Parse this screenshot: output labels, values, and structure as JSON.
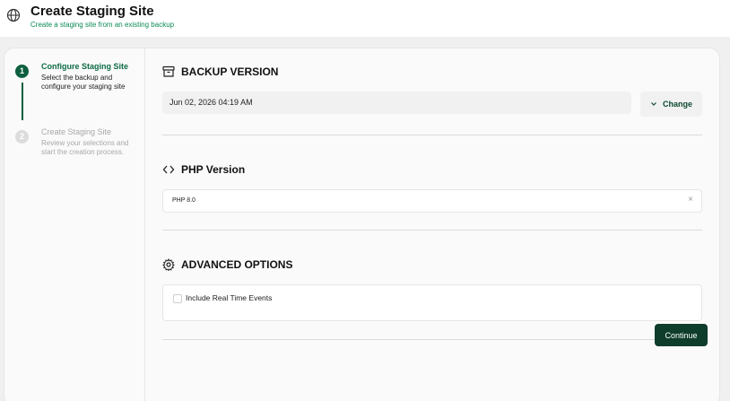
{
  "header": {
    "title": "Create Staging Site",
    "subtitle": "Create a staging site from an existing backup",
    "icon": "globe-icon"
  },
  "steps": [
    {
      "number": "1",
      "label": "Configure Staging Site",
      "description": "Select the backup and configure your staging site",
      "state": "active"
    },
    {
      "number": "2",
      "label": "Create Staging Site",
      "description": "Review your selections and start the creation process.",
      "state": "inactive"
    }
  ],
  "backup": {
    "heading": "BACKUP VERSION",
    "icon": "archive-icon",
    "value": "Jun 02, 2026 04:19 AM",
    "change_label": "Change"
  },
  "php": {
    "heading": "PHP Version",
    "icon": "code-icon",
    "selected": "PHP 8.0",
    "clear_glyph": "×"
  },
  "advanced": {
    "heading": "ADVANCED OPTIONS",
    "icon": "gear-icon",
    "option_label": "Include Real Time Events",
    "option_checked": false
  },
  "footer": {
    "continue_label": "Continue"
  },
  "colors": {
    "accent": "#0d5f3f",
    "button_dark": "#0f3d2c",
    "subtitle": "#0a8a55"
  }
}
